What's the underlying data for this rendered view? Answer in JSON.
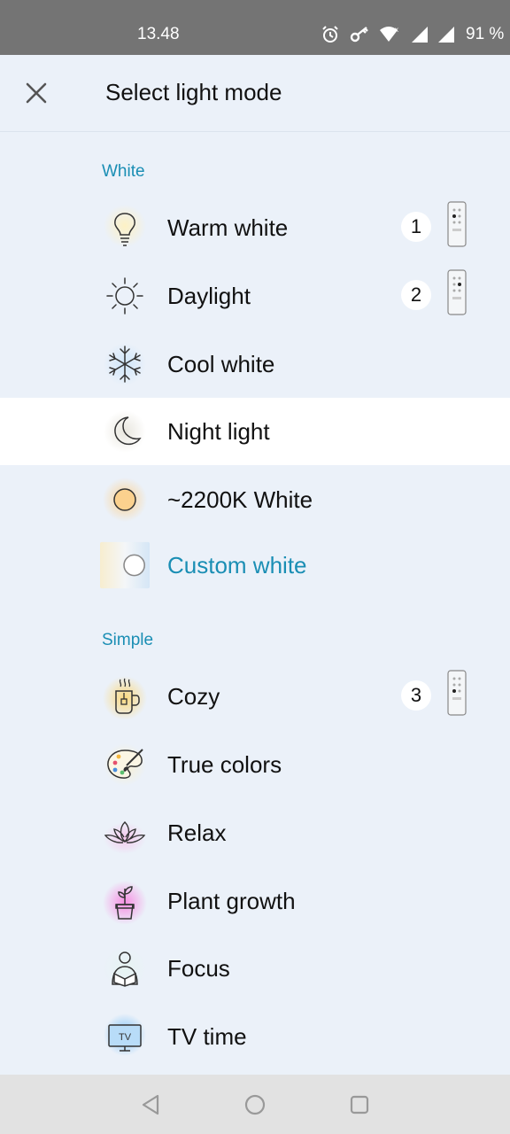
{
  "status_bar": {
    "time": "13.48",
    "battery": "91 %",
    "icons": [
      "alarm-icon",
      "key-icon",
      "wifi-icon",
      "signal-icon",
      "signal-icon"
    ]
  },
  "header": {
    "title": "Select light mode",
    "close_icon": "close-icon"
  },
  "sections": {
    "white": "White",
    "simple": "Simple"
  },
  "items": {
    "warm_white": {
      "label": "Warm white",
      "icon": "bulb-icon",
      "badge": "1"
    },
    "daylight": {
      "label": "Daylight",
      "icon": "sun-icon",
      "badge": "2"
    },
    "cool_white": {
      "label": "Cool white",
      "icon": "snowflake-icon"
    },
    "night_light": {
      "label": "Night light",
      "icon": "moon-icon",
      "selected": true
    },
    "k2200": {
      "label": "~2200K White",
      "icon": "circle-icon"
    },
    "custom_white": {
      "label": "Custom white",
      "icon": "custom-white-icon"
    },
    "cozy": {
      "label": "Cozy",
      "icon": "mug-icon",
      "badge": "3"
    },
    "true_colors": {
      "label": "True colors",
      "icon": "palette-icon"
    },
    "relax": {
      "label": "Relax",
      "icon": "lotus-icon"
    },
    "plant_growth": {
      "label": "Plant growth",
      "icon": "plant-icon"
    },
    "focus": {
      "label": "Focus",
      "icon": "person-reading-icon"
    },
    "tv_time": {
      "label": "TV time",
      "icon": "tv-icon",
      "icon_text": "TV"
    }
  },
  "nav": [
    "back-icon",
    "home-icon",
    "recents-icon"
  ],
  "colors": {
    "background": "#ebf1f9",
    "accent": "#1a8eb4",
    "selected_row": "#ffffff",
    "status_bar": "#747474"
  }
}
